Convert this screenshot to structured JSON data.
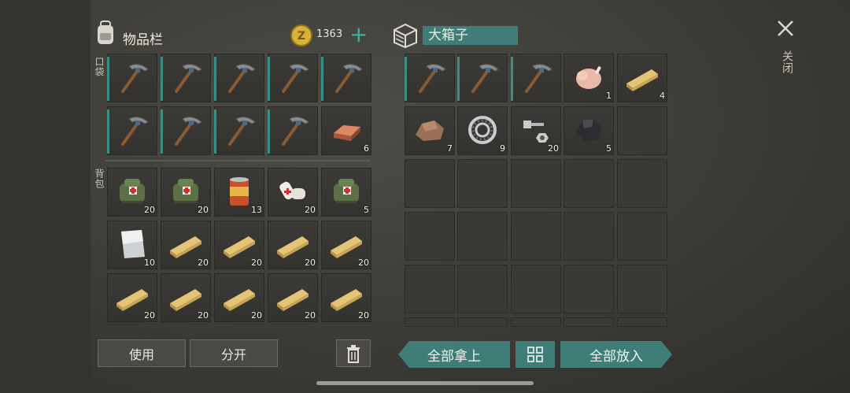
{
  "inventory": {
    "title": "物品栏",
    "coins": "1363",
    "pocket_label": "口袋",
    "backpack_label": "背包",
    "pocket_slots": [
      {
        "icon": "pickaxe-icon",
        "count": ""
      },
      {
        "icon": "pickaxe-icon",
        "count": ""
      },
      {
        "icon": "pickaxe-icon",
        "count": ""
      },
      {
        "icon": "pickaxe-icon",
        "count": ""
      },
      {
        "icon": "pickaxe-icon",
        "count": ""
      },
      {
        "icon": "pickaxe-icon",
        "count": ""
      },
      {
        "icon": "pickaxe-icon",
        "count": ""
      },
      {
        "icon": "pickaxe-icon",
        "count": ""
      },
      {
        "icon": "pickaxe-icon",
        "count": ""
      },
      {
        "icon": "copper-ingot-icon",
        "count": "6"
      }
    ],
    "backpack_slots": [
      {
        "icon": "medkit-bag-icon",
        "count": "20"
      },
      {
        "icon": "medkit-bag-icon",
        "count": "20"
      },
      {
        "icon": "canned-food-icon",
        "count": "13"
      },
      {
        "icon": "bandage-icon",
        "count": "20"
      },
      {
        "icon": "medkit-bag-icon",
        "count": "5"
      },
      {
        "icon": "metal-sheet-icon",
        "count": "10"
      },
      {
        "icon": "wood-plank-icon",
        "count": "20"
      },
      {
        "icon": "wood-plank-icon",
        "count": "20"
      },
      {
        "icon": "wood-plank-icon",
        "count": "20"
      },
      {
        "icon": "wood-plank-icon",
        "count": "20"
      },
      {
        "icon": "wood-plank-icon",
        "count": "20"
      },
      {
        "icon": "wood-plank-icon",
        "count": "20"
      },
      {
        "icon": "wood-plank-icon",
        "count": "20"
      },
      {
        "icon": "wood-plank-icon",
        "count": "20"
      },
      {
        "icon": "wood-plank-icon",
        "count": "20"
      }
    ],
    "use_label": "使用",
    "split_label": "分开"
  },
  "chest": {
    "title": "大箱子",
    "slots": [
      {
        "icon": "pickaxe-icon",
        "count": ""
      },
      {
        "icon": "pickaxe-icon",
        "count": ""
      },
      {
        "icon": "pickaxe-icon",
        "count": ""
      },
      {
        "icon": "raw-chicken-icon",
        "count": "1"
      },
      {
        "icon": "wood-plank-icon",
        "count": "4"
      },
      {
        "icon": "stone-ore-icon",
        "count": "7"
      },
      {
        "icon": "bearing-icon",
        "count": "9"
      },
      {
        "icon": "bolt-nut-icon",
        "count": "20"
      },
      {
        "icon": "coal-icon",
        "count": "5"
      }
    ],
    "take_all_label": "全部拿上",
    "put_all_label": "全部放入"
  },
  "close_label": "关闭",
  "colors": {
    "accent": "#3f7d78",
    "coin": "#d8b23a",
    "plus": "#3fb0a0"
  }
}
